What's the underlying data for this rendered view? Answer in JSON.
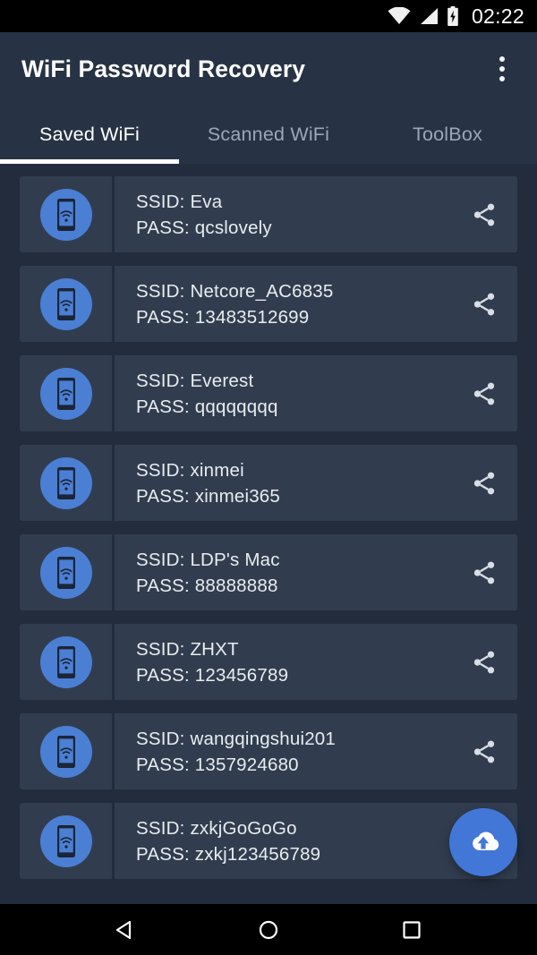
{
  "statusbar": {
    "time": "02:22",
    "icons": [
      "wifi-icon",
      "signal-icon",
      "battery-charging-icon"
    ]
  },
  "appbar": {
    "title": "WiFi Password Recovery",
    "overflow_label": "overflow-menu"
  },
  "tabs": [
    {
      "label": "Saved WiFi",
      "active": true
    },
    {
      "label": "Scanned WiFi",
      "active": false
    },
    {
      "label": "ToolBox",
      "active": false
    }
  ],
  "labels": {
    "ssid_prefix": "SSID:",
    "pass_prefix": "PASS:"
  },
  "networks": [
    {
      "ssid": "SSID:  Eva",
      "pass": "PASS:  qcslovely"
    },
    {
      "ssid": "SSID:  Netcore_AC6835",
      "pass": "PASS:  13483512699"
    },
    {
      "ssid": "SSID:  Everest",
      "pass": "PASS:  qqqqqqqq"
    },
    {
      "ssid": "SSID:  xinmei",
      "pass": "PASS:  xinmei365"
    },
    {
      "ssid": "SSID:  LDP's Mac",
      "pass": "PASS:  88888888"
    },
    {
      "ssid": "SSID:  ZHXT",
      "pass": "PASS:  123456789"
    },
    {
      "ssid": "SSID:  wangqingshui201",
      "pass": "PASS:  1357924680"
    },
    {
      "ssid": "SSID:  zxkjGoGoGo",
      "pass": "PASS:  zxkj123456789"
    }
  ],
  "fab": {
    "icon": "cloud-upload-icon"
  },
  "navbar": {
    "back": "back-icon",
    "home": "home-icon",
    "recents": "recents-icon"
  },
  "colors": {
    "accent": "#4277d8",
    "avatar": "#4a7fd4",
    "card_bg": "#313d4f",
    "page_bg": "#222c3c",
    "appbar_bg": "#273344",
    "text": "#e8ecf1",
    "text_muted": "#9ba7b6"
  }
}
